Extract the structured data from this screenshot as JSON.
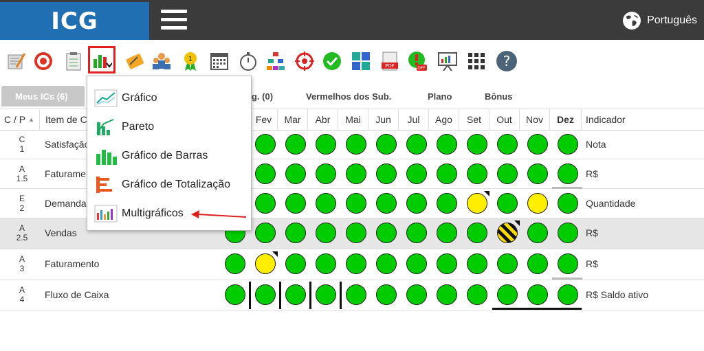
{
  "app": {
    "logo": "ICG",
    "language": "Português"
  },
  "toolbar": {
    "icons": [
      "edit-icon",
      "target-icon",
      "checklist-icon",
      "chart-icon",
      "attach-icon",
      "team-icon",
      "award-icon",
      "calendar-icon",
      "stopwatch-icon",
      "org-chart-icon",
      "crosshair-icon",
      "check-icon",
      "puzzle-icon",
      "pdf-icon",
      "alert-off-icon",
      "presentation-icon",
      "grid-icon",
      "help-icon"
    ]
  },
  "tabs": {
    "active": "Meus ICs (6)",
    "partial": "g. (0)",
    "red_sub": "Vermelhos dos Sub.",
    "plan": "Plano",
    "bonus": "Bônus"
  },
  "table": {
    "col_cp": "C / P",
    "col_item": "Item de C",
    "months": [
      "Fev",
      "Mar",
      "Abr",
      "Mai",
      "Jun",
      "Jul",
      "Ago",
      "Set",
      "Out",
      "Nov",
      "Dez"
    ],
    "col_indicator": "Indicador",
    "rows": [
      {
        "c": "C",
        "p": "1",
        "item": "Satisfação",
        "indicator": "Nota"
      },
      {
        "c": "A",
        "p": "1.5",
        "item": "Faturame",
        "indicator": "R$"
      },
      {
        "c": "E",
        "p": "2",
        "item": "Demanda",
        "indicator": "Quantidade"
      },
      {
        "c": "A",
        "p": "2.5",
        "item": "Vendas",
        "indicator": "R$"
      },
      {
        "c": "A",
        "p": "3",
        "item": "Faturamento",
        "indicator": "R$"
      },
      {
        "c": "A",
        "p": "4",
        "item": "Fluxo de Caixa",
        "indicator": "R$ Saldo ativo"
      }
    ]
  },
  "dropdown": {
    "items": [
      "Gráfico",
      "Pareto",
      "Gráfico de Barras",
      "Gráfico de Totalização",
      "Multigráficos"
    ]
  },
  "colors": {
    "header_bg": "#3b3b3b",
    "logo_bg": "#1f6fb2",
    "status_green": "#00cc00",
    "status_yellow": "#ffee00",
    "highlight_red": "#e02020"
  }
}
